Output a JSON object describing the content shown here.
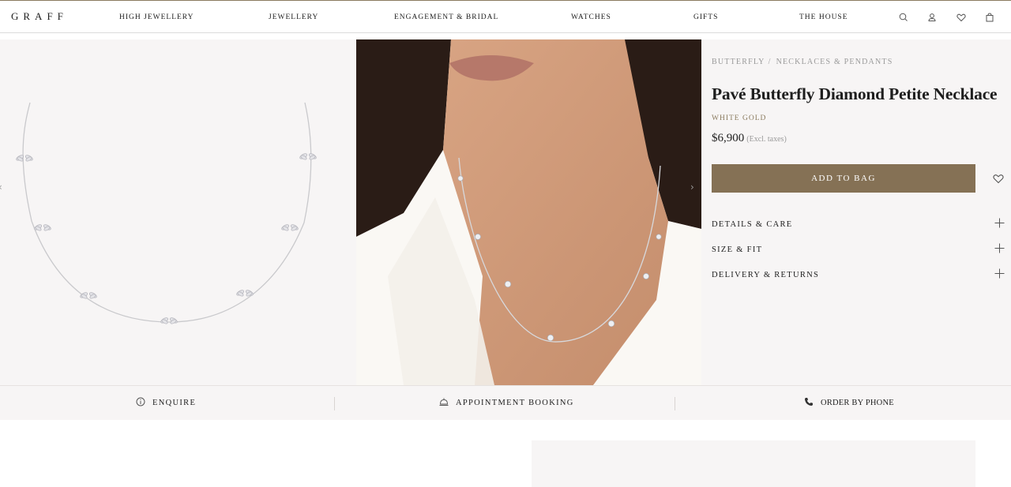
{
  "header": {
    "logo": "GRAFF",
    "nav": [
      "HIGH JEWELLERY",
      "JEWELLERY",
      "ENGAGEMENT & BRIDAL",
      "WATCHES",
      "GIFTS",
      "THE HOUSE"
    ],
    "icons": [
      "search-icon",
      "account-icon",
      "wishlist-icon",
      "bag-icon"
    ]
  },
  "product": {
    "breadcrumb": [
      "BUTTERFLY",
      "NECKLACES & PENDANTS"
    ],
    "breadcrumb_sep": "/",
    "title": "Pavé Butterfly Diamond Petite Necklace",
    "metal": "WHITE GOLD",
    "price": "$6,900",
    "tax_note": "(Excl. taxes)",
    "add_to_bag": "ADD TO BAG",
    "accordions": [
      "DETAILS & CARE",
      "SIZE & FIT",
      "DELIVERY & RETURNS"
    ]
  },
  "gallery": {
    "images": [
      "necklace-product-image",
      "model-wearing-necklace-image"
    ]
  },
  "actions": {
    "enquire": "ENQUIRE",
    "appointment": "APPOINTMENT BOOKING",
    "phone": "ORDER BY PHONE"
  },
  "colors": {
    "accent": "#857155",
    "panel_bg": "#f7f5f5",
    "text": "#1e1e1e",
    "muted": "#9a9a9a"
  }
}
